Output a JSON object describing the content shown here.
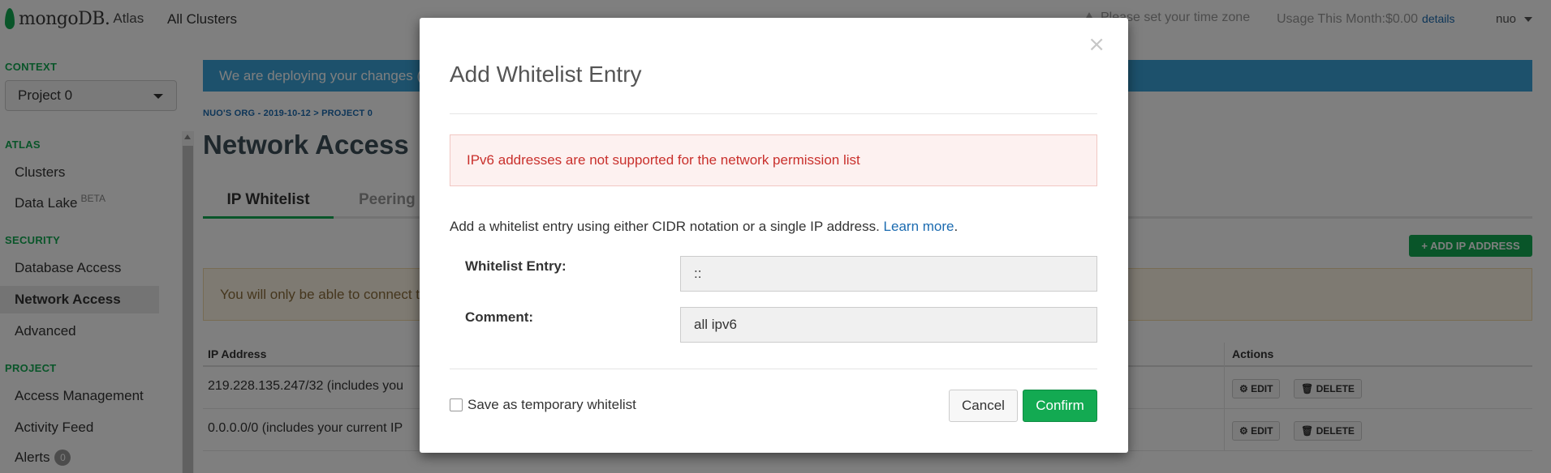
{
  "header": {
    "logo_text": "mongoDB.",
    "logo_suffix": "Atlas",
    "all_clusters": "All Clusters",
    "timezone_notice": "Please set your time zone",
    "usage": "Usage This Month:$0.00",
    "usage_details": "details",
    "user": "nuo"
  },
  "sidebar": {
    "context_label": "CONTEXT",
    "project_select": "Project 0",
    "atlas_label": "ATLAS",
    "clusters": "Clusters",
    "data_lake": "Data Lake",
    "data_lake_badge": "BETA",
    "security_label": "SECURITY",
    "database_access": "Database Access",
    "network_access": "Network Access",
    "advanced": "Advanced",
    "project_label": "PROJECT",
    "access_management": "Access Management",
    "activity_feed": "Activity Feed",
    "alerts": "Alerts",
    "alerts_count": "0"
  },
  "main": {
    "deploy_banner": "We are deploying your changes (",
    "breadcrumb": "NUO'S ORG - 2019-10-12 > PROJECT 0",
    "page_title": "Network Access",
    "tab_ip_whitelist": "IP Whitelist",
    "tab_peering": "Peering",
    "add_ip_button": "+ ADD IP ADDRESS",
    "warning_banner": "You will only be able to connect to",
    "table": {
      "col_ip": "IP Address",
      "col_actions": "Actions",
      "rows": [
        {
          "ip": "219.228.135.247/32  (includes you"
        },
        {
          "ip": "0.0.0.0/0  (includes your current IP"
        }
      ],
      "edit_label": "EDIT",
      "delete_label": "DELETE"
    }
  },
  "modal": {
    "title": "Add Whitelist Entry",
    "close": "×",
    "alert": "IPv6 addresses are not supported for the network permission list",
    "help_text": "Add a whitelist entry using either CIDR notation or a single IP address.",
    "help_link": "Learn more",
    "whitelist_label": "Whitelist Entry:",
    "whitelist_value": "::",
    "comment_label": "Comment:",
    "comment_value": "all ipv6",
    "temp_label": "Save as temporary whitelist",
    "cancel": "Cancel",
    "confirm": "Confirm"
  },
  "colors": {
    "brand_green": "#13aa52",
    "banner_blue": "#3aa3d8",
    "link_blue": "#1b6bb0",
    "error_red": "#c9302c"
  }
}
